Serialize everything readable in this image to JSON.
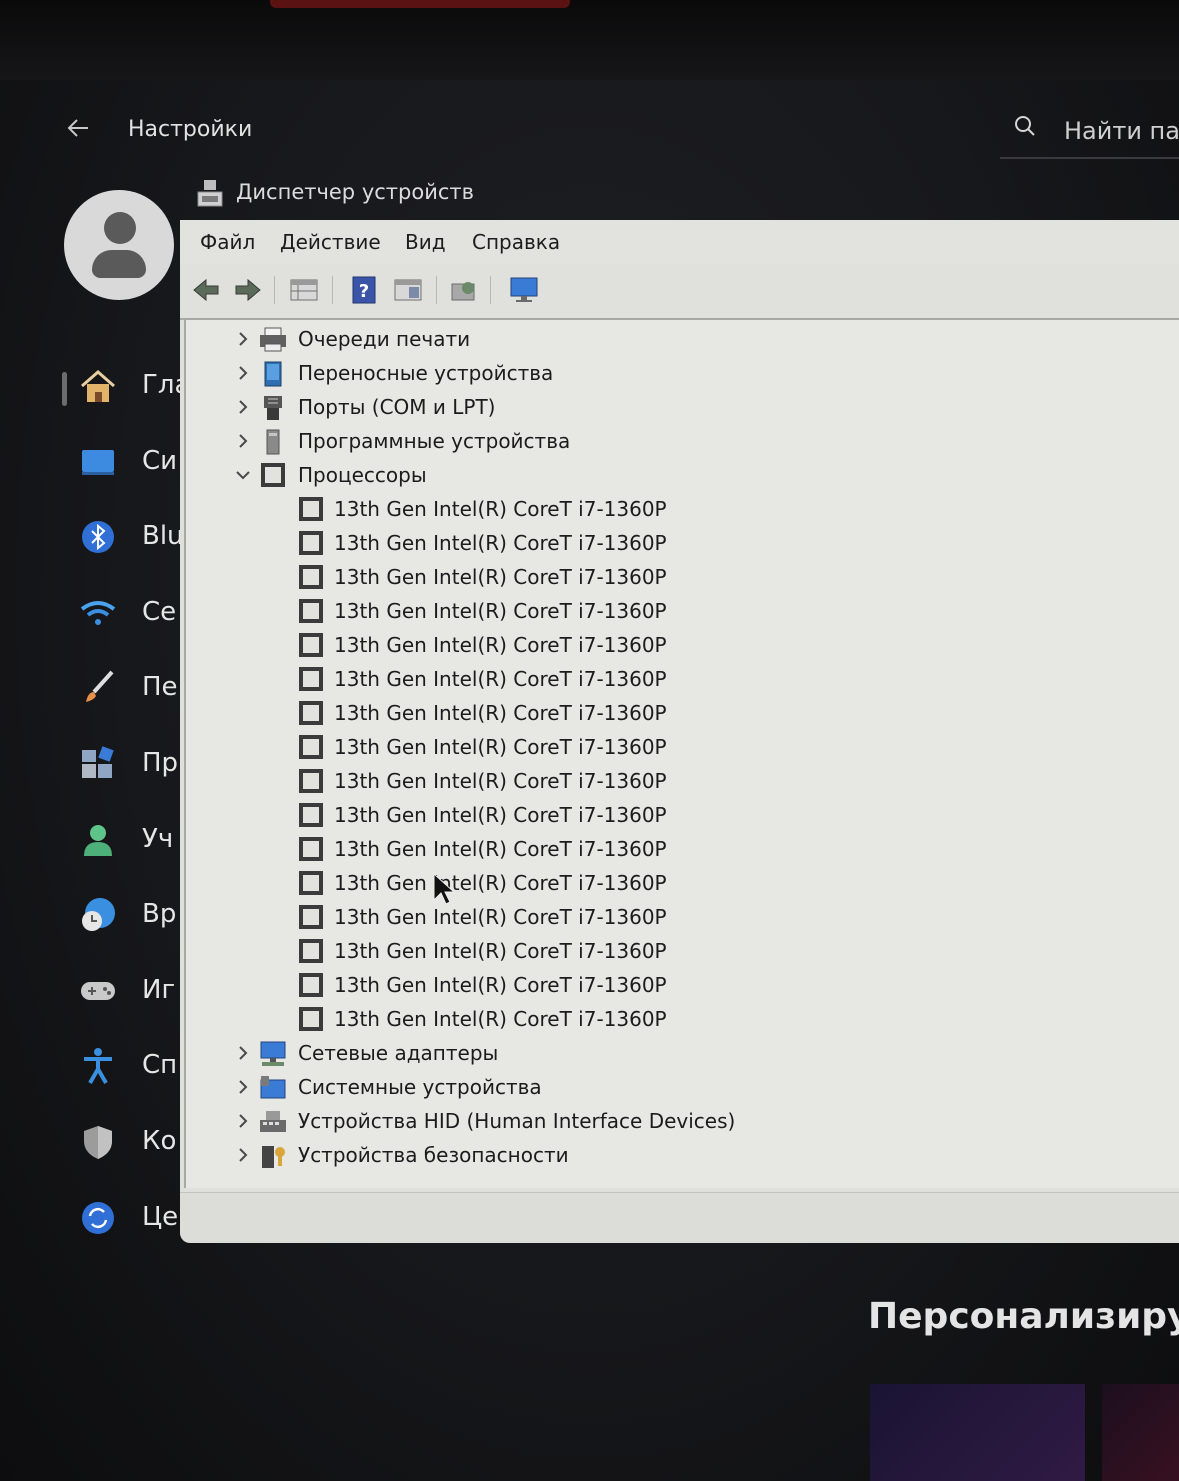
{
  "settings": {
    "title": "Настройки",
    "search_placeholder": "Найти пар",
    "nav": [
      {
        "label": "Гла",
        "icon": "home-icon"
      },
      {
        "label": "Си",
        "icon": "system-display-icon"
      },
      {
        "label": "Blu",
        "icon": "bluetooth-icon"
      },
      {
        "label": "Се",
        "icon": "wifi-icon"
      },
      {
        "label": "Пе",
        "icon": "brush-icon"
      },
      {
        "label": "Пр",
        "icon": "apps-icon"
      },
      {
        "label": "Уч",
        "icon": "account-icon"
      },
      {
        "label": "Вр",
        "icon": "time-language-icon"
      },
      {
        "label": "Иг",
        "icon": "gamepad-icon"
      },
      {
        "label": "Сп",
        "icon": "accessibility-icon"
      },
      {
        "label": "Ко",
        "icon": "shield-icon"
      },
      {
        "label": "Це",
        "icon": "update-icon"
      }
    ],
    "bottom_heading": "Персонализируйт"
  },
  "device_manager": {
    "title": "Диспетчер устройств",
    "menu": [
      "Файл",
      "Действие",
      "Вид",
      "Справка"
    ],
    "toolbar_icons": [
      "back-arrow-icon",
      "forward-arrow-icon",
      "properties-grid-icon",
      "help-icon",
      "view-panel-icon",
      "update-driver-icon",
      "monitor-icon"
    ],
    "tree_before": [
      {
        "label": "Очереди печати",
        "icon": "printer-icon",
        "expanded": false
      },
      {
        "label": "Переносные устройства",
        "icon": "portable-device-icon",
        "expanded": false
      },
      {
        "label": "Порты (COM и LPT)",
        "icon": "port-icon",
        "expanded": false
      },
      {
        "label": "Программные устройства",
        "icon": "software-device-icon",
        "expanded": false
      }
    ],
    "processors_node": {
      "label": "Процессоры",
      "icon": "processor-icon",
      "expanded": true
    },
    "processors": [
      "13th Gen Intel(R) CoreT i7-1360P",
      "13th Gen Intel(R) CoreT i7-1360P",
      "13th Gen Intel(R) CoreT i7-1360P",
      "13th Gen Intel(R) CoreT i7-1360P",
      "13th Gen Intel(R) CoreT i7-1360P",
      "13th Gen Intel(R) CoreT i7-1360P",
      "13th Gen Intel(R) CoreT i7-1360P",
      "13th Gen Intel(R) CoreT i7-1360P",
      "13th Gen Intel(R) CoreT i7-1360P",
      "13th Gen Intel(R) CoreT i7-1360P",
      "13th Gen Intel(R) CoreT i7-1360P",
      "13th Gen Intel(R) CoreT i7-1360P",
      "13th Gen Intel(R) CoreT i7-1360P",
      "13th Gen Intel(R) CoreT i7-1360P",
      "13th Gen Intel(R) CoreT i7-1360P",
      "13th Gen Intel(R) CoreT i7-1360P"
    ],
    "tree_after": [
      {
        "label": "Сетевые адаптеры",
        "icon": "network-adapter-icon",
        "expanded": false
      },
      {
        "label": "Системные устройства",
        "icon": "system-device-icon",
        "expanded": false
      },
      {
        "label": "Устройства HID (Human Interface Devices)",
        "icon": "hid-icon",
        "expanded": false
      },
      {
        "label": "Устройства безопасности",
        "icon": "security-device-icon",
        "expanded": false
      }
    ]
  },
  "colors": {
    "settings_bg": "#17181b",
    "window_bg": "#e7e7e3",
    "accent_blue": "#3a7bd5"
  }
}
